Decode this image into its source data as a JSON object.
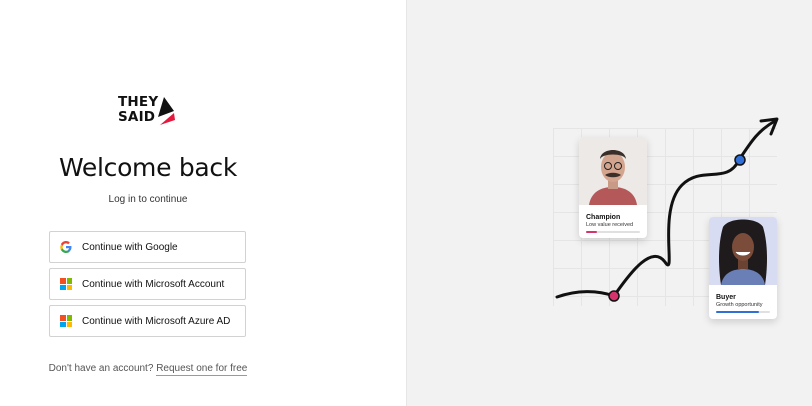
{
  "brand": {
    "line1": "THEY",
    "line2": "SAID"
  },
  "heading": "Welcome back",
  "subheading": "Log in to continue",
  "buttons": [
    {
      "label": "Continue with Google",
      "icon": "google-icon"
    },
    {
      "label": "Continue with Microsoft Account",
      "icon": "microsoft-icon"
    },
    {
      "label": "Continue with Microsoft Azure AD",
      "icon": "microsoft-icon"
    }
  ],
  "signup": {
    "prompt": "Don't have an account?",
    "link": "Request one for free"
  },
  "cards": [
    {
      "name": "Champion",
      "role": "Low value received",
      "progress": 0.2,
      "progress_color": "#d6336c"
    },
    {
      "name": "Buyer",
      "role": "Growth opportunity",
      "progress": 0.8,
      "progress_color": "#2f6fd6"
    }
  ],
  "colors": {
    "brand_red": "#e5193d",
    "accent_red": "#d6336c",
    "accent_blue": "#2f6fd6",
    "right_panel_bg": "#f2f2f2"
  }
}
